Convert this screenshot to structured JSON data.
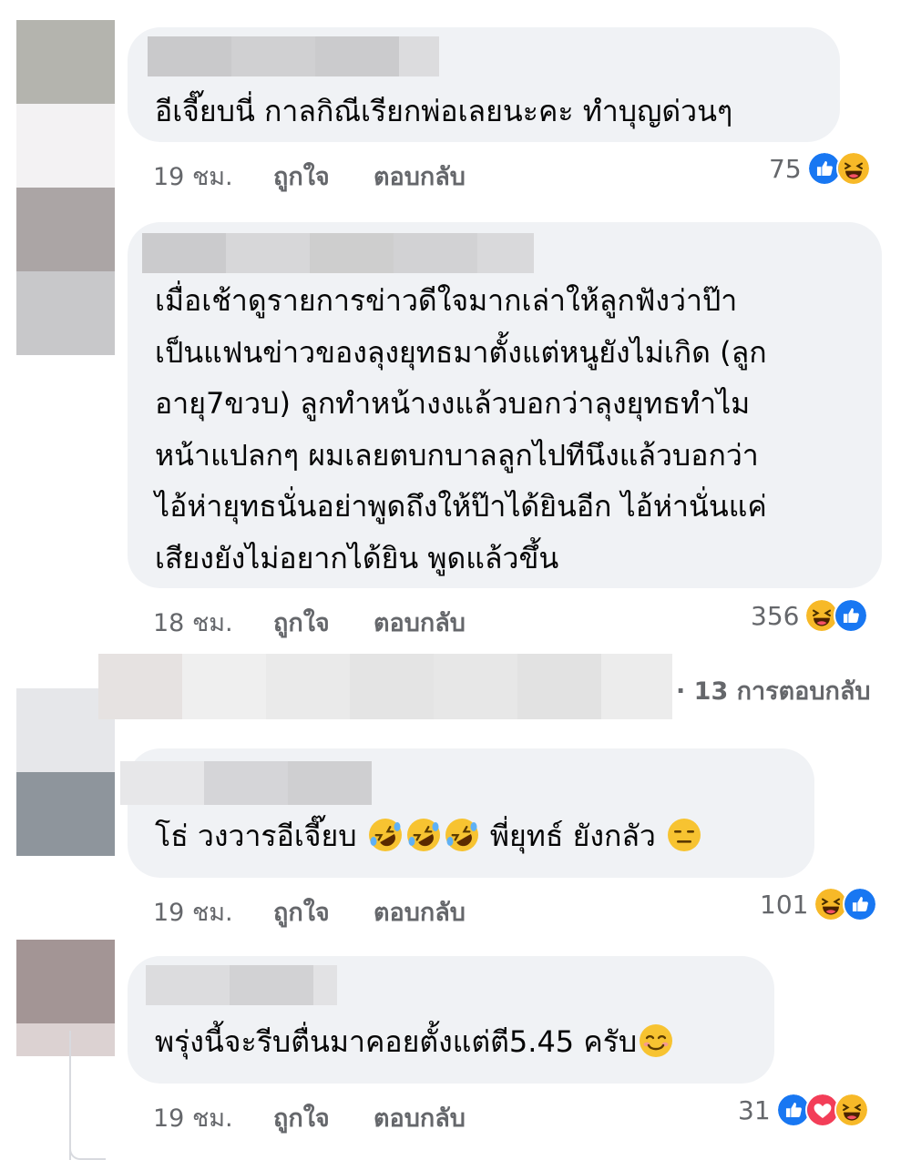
{
  "comments": [
    {
      "lines": [
        "อีเจี๊ยบนี่ กาลกิณีเรียกพ่อเลยนะคะ ทำบุญด่วนๆ"
      ],
      "time": "19 ชม.",
      "like_label": "ถูกใจ",
      "reply_label": "ตอบกลับ",
      "reaction_count": "75",
      "reactions": [
        "like-icon",
        "haha-icon"
      ]
    },
    {
      "lines": [
        "เมื่อเช้าดูรายการข่าวดีใจมากเล่าให้ลูกฟังว่าป๊า",
        "เป็นแฟนข่าวของลุงยุทธมาตั้งแต่หนูยังไม่เกิด (ลูก",
        "อายุ7ขวบ) ลูกทำหน้างงแล้วบอกว่าลุงยุทธทำไม",
        "หน้าแปลกๆ ผมเลยตบกบาลลูกไปทีนึงแล้วบอกว่า",
        "ไอ้ห่ายุทธนั่นอย่าพูดถึงให้ป๊าได้ยินอีก ไอ้ห่านั่นแค่",
        "เสียงยังไม่อยากได้ยิน พูดแล้วขึ้น"
      ],
      "time": "18 ชม.",
      "like_label": "ถูกใจ",
      "reply_label": "ตอบกลับ",
      "reaction_count": "356",
      "reactions": [
        "haha-icon",
        "like-icon"
      ],
      "replies_label": "· 13 การตอบกลับ"
    },
    {
      "text_before": "โธ่ วงวารอีเจี๊ยบ",
      "text_middle": "พี่ยุทธ์ ยังกลัว",
      "inline_emojis": [
        "rofl-emoji",
        "rofl-emoji",
        "rofl-emoji"
      ],
      "trailing_emoji": "expressionless-emoji",
      "time": "19 ชม.",
      "like_label": "ถูกใจ",
      "reply_label": "ตอบกลับ",
      "reaction_count": "101",
      "reactions": [
        "haha-icon",
        "like-icon"
      ]
    },
    {
      "text": "พรุ่งนี้จะรีบตื่นมาคอยตั้งแต่ตี5.45 ครับ",
      "trailing_emoji": "smiling-face-emoji",
      "time": "19 ชม.",
      "like_label": "ถูกใจ",
      "reply_label": "ตอบกลับ",
      "reaction_count": "31",
      "reactions": [
        "like-icon",
        "love-icon",
        "haha-icon"
      ]
    }
  ],
  "colors": {
    "bubble": "#f0f2f5",
    "meta_text": "#65676b",
    "like_blue": "#1877f2",
    "haha_yellow": "#f7b928",
    "love_red": "#f33e58"
  }
}
